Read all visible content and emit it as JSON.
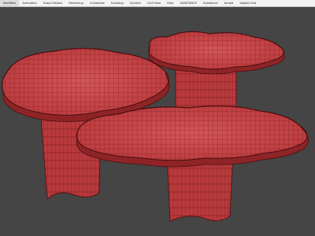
{
  "menubar": {
    "items": [
      "Modifiers",
      "Animation",
      "Graph Editors",
      "Rendering",
      "Customize",
      "Scripting",
      "Content",
      "Civil View",
      "Help",
      "SUBSTANCE",
      "Substance",
      "Arnold",
      "Spatial Grid"
    ]
  },
  "viewport": {
    "background_color": "#454545",
    "mesh_color": "#c9474a",
    "mesh_edge_color": "#7a1a1d",
    "objects": [
      "table-left",
      "table-back-right",
      "table-front-right"
    ]
  }
}
